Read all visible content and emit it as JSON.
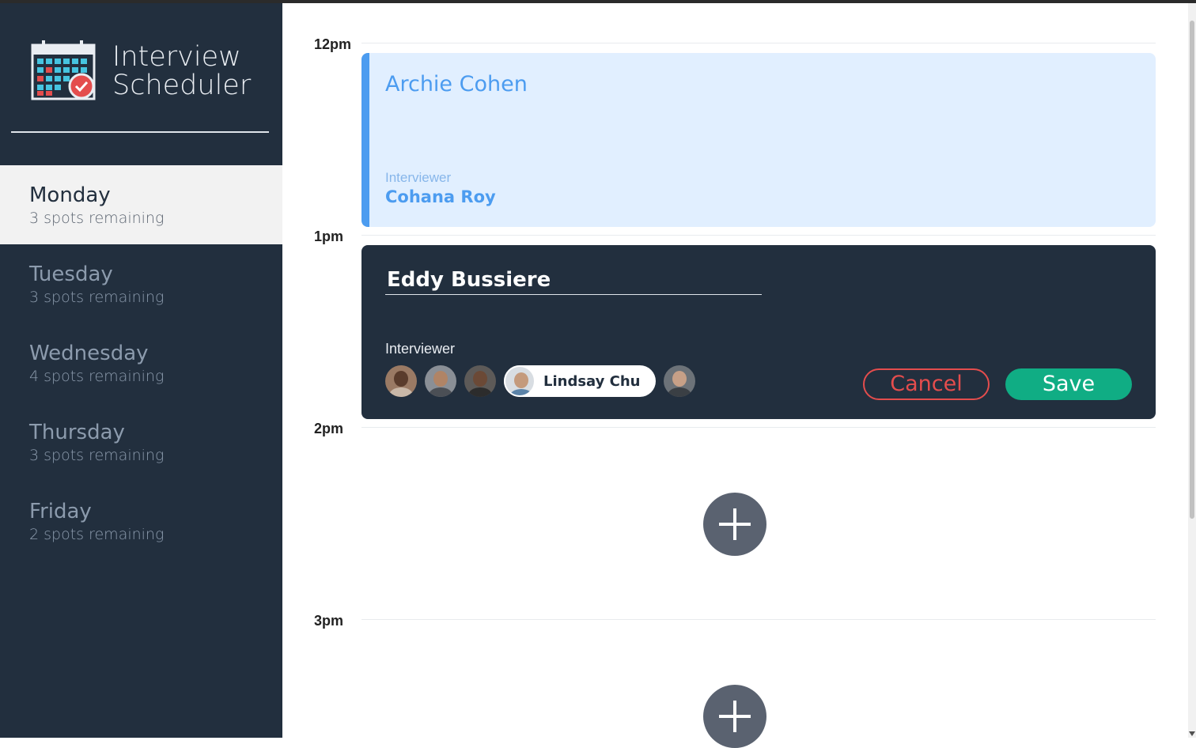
{
  "app": {
    "title_line1": "Interview",
    "title_line2": "Scheduler",
    "logo_icon": "calendar-check-icon"
  },
  "days": [
    {
      "name": "Monday",
      "spots": "3 spots remaining",
      "selected": true
    },
    {
      "name": "Tuesday",
      "spots": "3 spots remaining"
    },
    {
      "name": "Wednesday",
      "spots": "4 spots remaining"
    },
    {
      "name": "Thursday",
      "spots": "3 spots remaining"
    },
    {
      "name": "Friday",
      "spots": "2 spots remaining"
    }
  ],
  "times": [
    "12pm",
    "1pm",
    "2pm",
    "3pm"
  ],
  "appointment_show": {
    "student": "Archie Cohen",
    "interviewer_label": "Interviewer",
    "interviewer": "Cohana Roy"
  },
  "appointment_form": {
    "student_value": "Eddy Bussiere",
    "interviewer_label": "Interviewer",
    "selected_interviewer": "Lindsay Chu",
    "cancel_label": "Cancel",
    "save_label": "Save"
  },
  "colors": {
    "sidebar_bg": "#222f3e",
    "accent_blue": "#4c9cf0",
    "show_bg": "#e1efff",
    "danger": "#e44d4d",
    "success": "#10ad84",
    "add_button": "#5a6270"
  }
}
